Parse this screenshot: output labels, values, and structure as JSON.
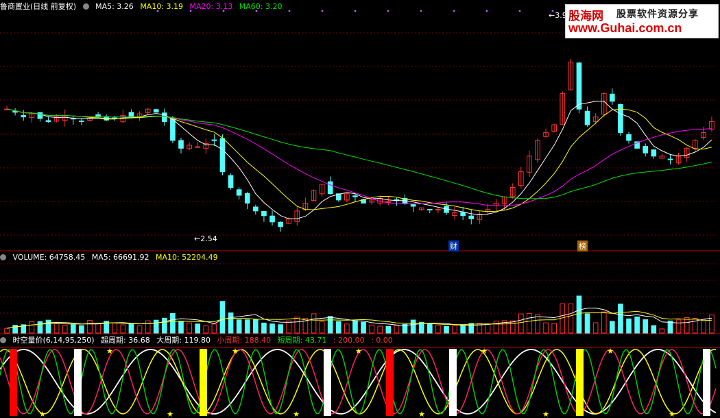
{
  "header": {
    "title": "鲁商置业(日线 前复权)",
    "ma5": "MA5: 3.26",
    "ma10": "MA10: 3.19",
    "ma20": "MA20: 3.13",
    "ma60": "MA60: 3.20"
  },
  "volume_panel": {
    "volume": "VOLUME: 64758.45",
    "ma5": "MA5: 66691.92",
    "ma10": "MA10: 52204.49"
  },
  "indicator_panel": {
    "name": "时空量价(6,14,95,250)",
    "super": "超周期: 36.68",
    "big": "大周期: 119.80",
    "small": "小周期: 188.40",
    "short": "短周期: 43.71",
    "v200": ": 200.00",
    "v0": ": 0.00"
  },
  "annotations": {
    "low": "2.54",
    "high": "3.9",
    "event1": "财",
    "event2": "榜"
  },
  "logo": {
    "brand": "股海网",
    "tagline": "股票软件资源分享",
    "url": "www.Guhai.com.cn"
  },
  "colors": {
    "up": "#ff3232",
    "down": "#54fcfc",
    "ma5": "#ffffff",
    "ma10": "#ffff00",
    "ma20": "#ff00ff",
    "ma60": "#00e600",
    "grid": "#7a0000"
  },
  "chart_data": [
    {
      "type": "line",
      "name": "price",
      "low_label": 2.54,
      "high_label": 3.9,
      "ma_latest": {
        "MA5": 3.26,
        "MA10": 3.19,
        "MA20": 3.13,
        "MA60": 3.2
      },
      "candles_close": [
        3.3,
        3.28,
        3.25,
        3.27,
        3.24,
        3.22,
        3.25,
        3.26,
        3.24,
        3.22,
        3.24,
        3.25,
        3.23,
        3.24,
        3.26,
        3.25,
        3.27,
        3.3,
        3.28,
        3.22,
        3.1,
        3.05,
        3.07,
        3.06,
        3.08,
        3.1,
        2.9,
        2.8,
        2.75,
        2.7,
        2.65,
        2.62,
        2.58,
        2.55,
        2.6,
        2.65,
        2.7,
        2.78,
        2.82,
        2.76,
        2.72,
        2.76,
        2.74,
        2.7,
        2.72,
        2.73,
        2.71,
        2.72,
        2.7,
        2.68,
        2.67,
        2.66,
        2.66,
        2.64,
        2.64,
        2.62,
        2.6,
        2.63,
        2.66,
        2.7,
        2.74,
        2.8,
        2.9,
        3.0,
        3.1,
        3.15,
        3.2,
        3.4,
        3.6,
        3.3,
        3.2,
        3.25,
        3.4,
        3.35,
        3.15,
        3.1,
        3.05,
        3.02,
        3.0,
        3.0,
        2.98,
        3.0,
        3.05,
        3.1,
        3.15,
        3.22
      ]
    },
    {
      "type": "bar",
      "name": "volume",
      "values_latest": {
        "VOLUME": 64758.45,
        "MA5": 66691.92,
        "MA10": 52204.49
      }
    },
    {
      "type": "line",
      "name": "时空量价(6,14,95,250)",
      "series_latest": {
        "超周期": 36.68,
        "大周期": 119.8,
        "小周期": 188.4,
        "短周期": 43.71
      },
      "ylim": [
        0,
        200
      ]
    }
  ]
}
